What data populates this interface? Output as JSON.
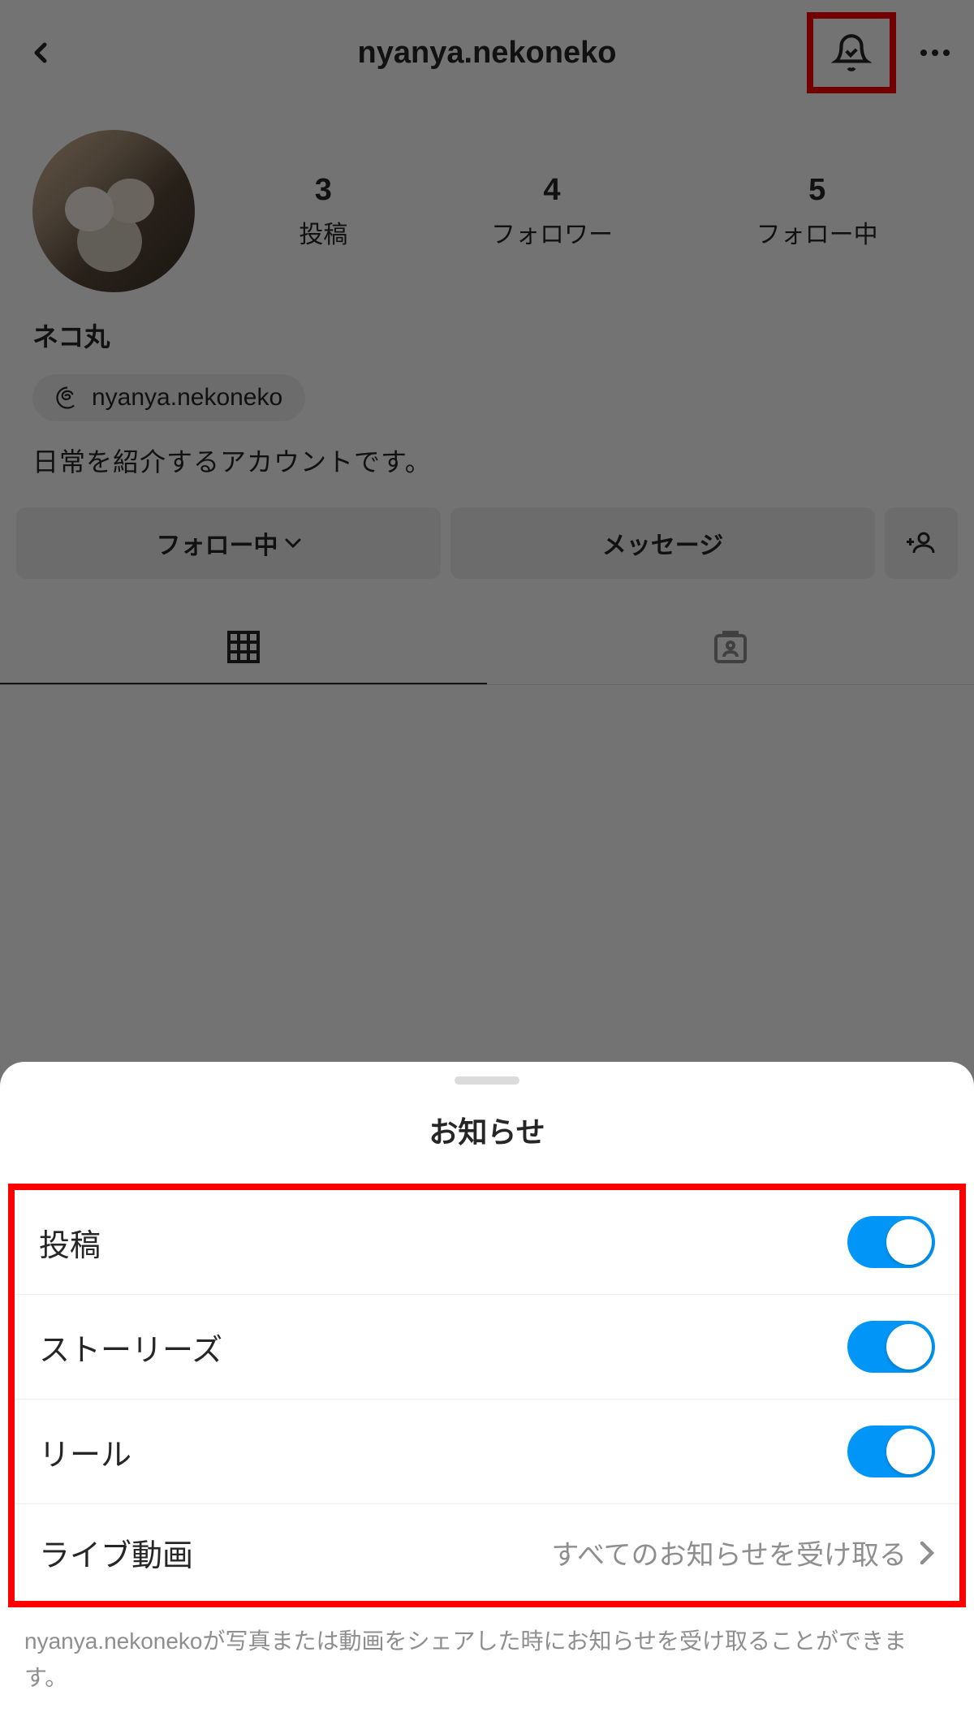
{
  "header": {
    "username": "nyanya.nekoneko"
  },
  "profile": {
    "displayName": "ネコ丸",
    "threadsHandle": "nyanya.nekoneko",
    "bio": "日常を紹介するアカウントです。",
    "stats": {
      "posts": {
        "value": "3",
        "label": "投稿"
      },
      "followers": {
        "value": "4",
        "label": "フォロワー"
      },
      "following": {
        "value": "5",
        "label": "フォロー中"
      }
    }
  },
  "actions": {
    "follow": "フォロー中",
    "message": "メッセージ"
  },
  "sheet": {
    "title": "お知らせ",
    "options": {
      "posts": "投稿",
      "stories": "ストーリーズ",
      "reels": "リール",
      "live": "ライブ動画",
      "liveValue": "すべてのお知らせを受け取る"
    },
    "footer": "nyanya.nekonekoが写真または動画をシェアした時にお知らせを受け取ることができます。"
  }
}
